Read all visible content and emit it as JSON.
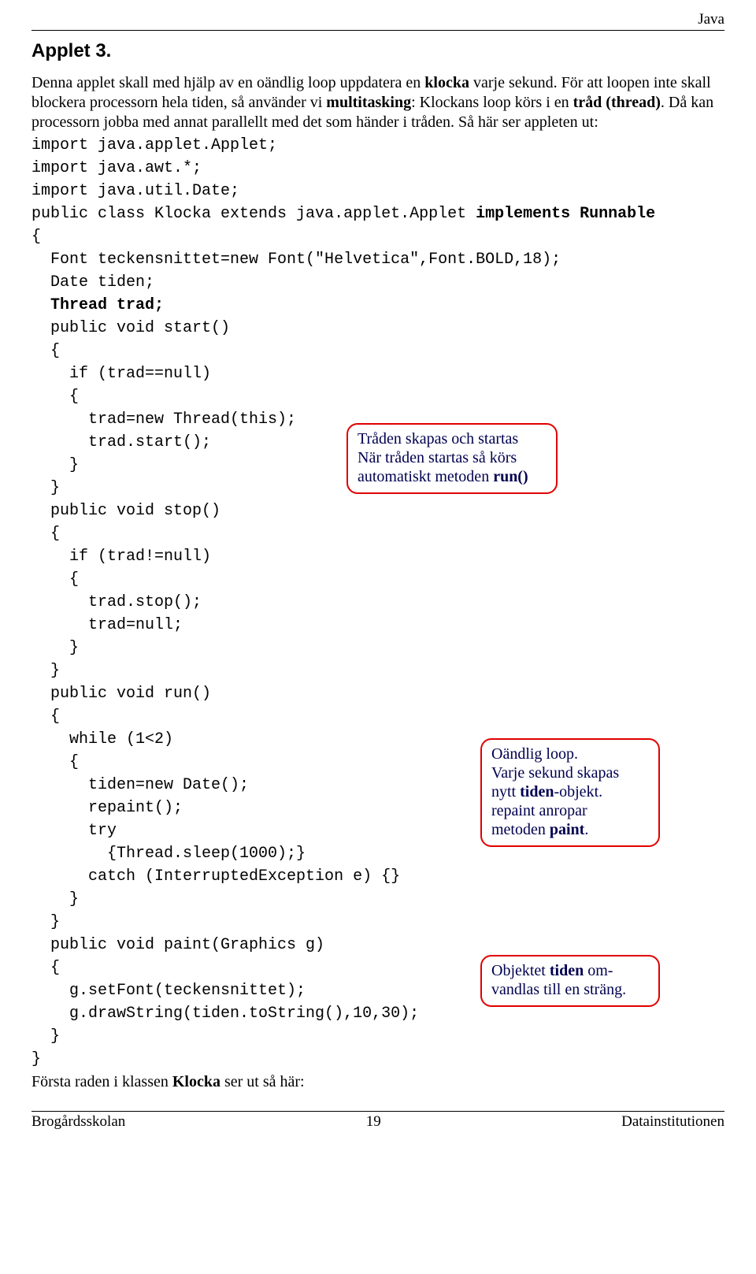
{
  "header": {
    "topright": "Java"
  },
  "title": "Applet 3.",
  "intro": {
    "p1_a": "Denna applet skall med hjälp av en oändlig loop uppdatera en ",
    "p1_b": "klocka",
    "p1_c": " varje sekund. För att loopen inte skall blockera processorn hela tiden, så använder vi ",
    "p1_d": "multitasking",
    "p1_e": ": Klockans loop körs i en ",
    "p1_f": "tråd (thread)",
    "p1_g": ". Då kan processorn jobba med annat parallellt med det som händer i tråden. Så här ser appleten ut:"
  },
  "code": {
    "l01": "import java.applet.Applet;",
    "l02": "import java.awt.*;",
    "l03": "import java.util.Date;",
    "l04": "",
    "l05a": "public class Klocka extends java.applet.Applet ",
    "l05b": "implements Runnable",
    "l06": "{",
    "l07": "  Font teckensnittet=new Font(\"Helvetica\",Font.BOLD,18);",
    "l08": "  Date tiden;",
    "l09a": "  ",
    "l09b": "Thread trad;",
    "l10": "",
    "l11": "  public void start()",
    "l12": "  {",
    "l13": "    if (trad==null)",
    "l14": "    {",
    "l15": "      trad=new Thread(this);",
    "l16": "      trad.start();",
    "l17": "    }",
    "l18": "  }",
    "l19": "",
    "l20": "  public void stop()",
    "l21": "  {",
    "l22": "    if (trad!=null)",
    "l23": "    {",
    "l24": "      trad.stop();",
    "l25": "      trad=null;",
    "l26": "    }",
    "l27": "  }",
    "l28": "",
    "l29": "  public void run()",
    "l30": "  {",
    "l31": "    while (1<2)",
    "l32": "    {",
    "l33": "      tiden=new Date();",
    "l34": "      repaint();",
    "l35": "      try",
    "l36": "        {Thread.sleep(1000);}",
    "l37": "      catch (InterruptedException e) {}",
    "l38": "    }",
    "l39": "  }",
    "l40": "",
    "l41": "  public void paint(Graphics g)",
    "l42": "  {",
    "l43": "    g.setFont(teckensnittet);",
    "l44": "    g.drawString(tiden.toString(),10,30);",
    "l45": "  }",
    "l46": "}"
  },
  "callouts": {
    "c1_l1": "Tråden skapas och startas",
    "c1_l2": "När tråden startas så körs",
    "c1_l3a": "automatiskt metoden ",
    "c1_l3b": "run()",
    "c2_l1": "Oändlig loop.",
    "c2_l2": "Varje sekund skapas",
    "c2_l3a": "nytt ",
    "c2_l3b": "tiden",
    "c2_l3c": "-objekt.",
    "c2_l4": "repaint anropar",
    "c2_l5a": "metoden ",
    "c2_l5b": "paint",
    "c2_l5c": ".",
    "c3_l1a": "Objektet ",
    "c3_l1b": "tiden",
    "c3_l1c": " om-",
    "c3_l2": "vandlas till en sträng."
  },
  "bottom": {
    "p_a": "Första raden i klassen ",
    "p_b": "Klocka",
    "p_c": " ser ut så här:"
  },
  "footer": {
    "left": "Brogårdsskolan",
    "center": "19",
    "right": "Datainstitutionen"
  }
}
